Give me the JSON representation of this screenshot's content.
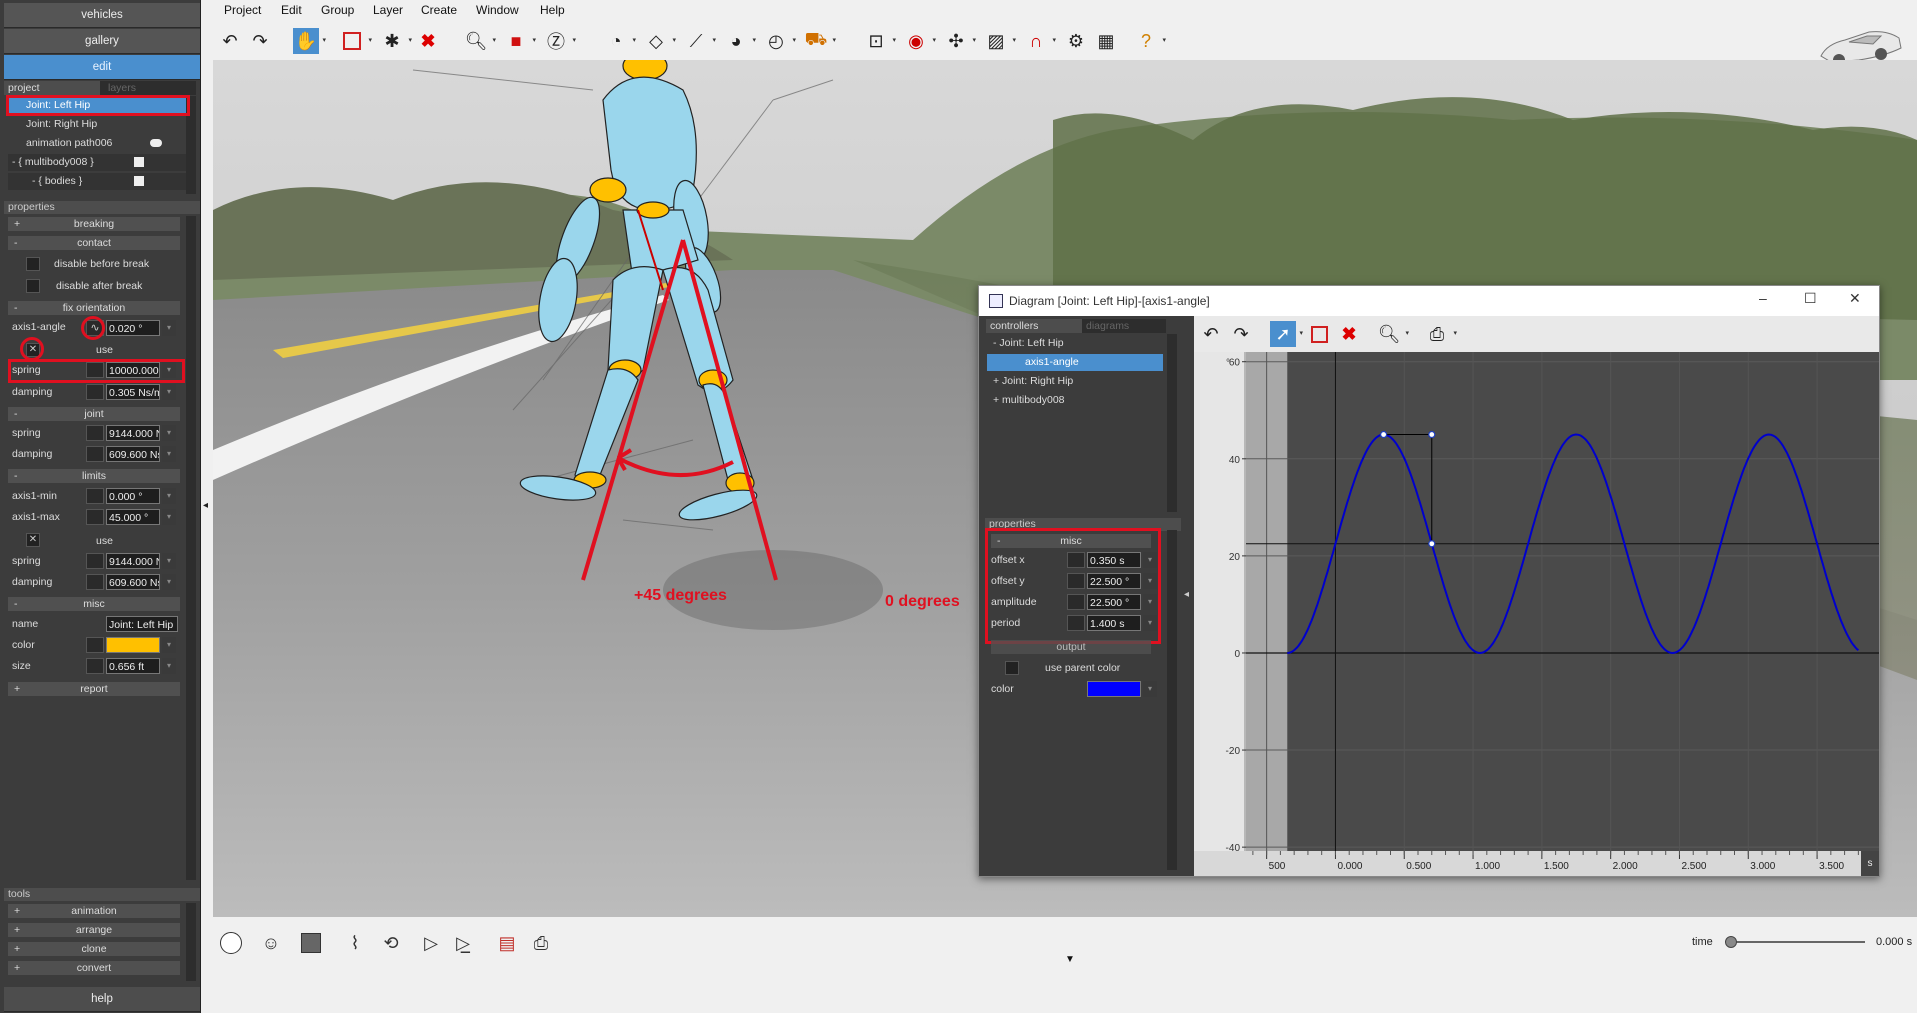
{
  "left_panel": {
    "nav": [
      "vehicles",
      "gallery",
      "edit"
    ],
    "project_tabs": {
      "project": "project",
      "layers": "layers"
    },
    "tree": [
      {
        "label": "Joint: Left Hip",
        "selected": true
      },
      {
        "label": "Joint: Right Hip",
        "selected": false
      },
      {
        "label": "animation path006",
        "selected": false
      },
      {
        "label": "- { multibody008 }",
        "selected": false
      },
      {
        "label": "- { bodies }",
        "selected": false
      }
    ],
    "properties_header": "properties",
    "sections": {
      "breaking": "breaking",
      "contact": "contact",
      "disable_before_break": "disable before break",
      "disable_after_break": "disable after break",
      "fix_orientation": "fix orientation",
      "axis1_angle_label": "axis1-angle",
      "axis1_angle_value": "0.020 °",
      "use_label": "use",
      "spring_label": "spring",
      "spring_value": "10000.000",
      "damping_label": "damping",
      "damping_value": "0.305 Ns/m",
      "joint": "joint",
      "joint_spring_label": "spring",
      "joint_spring_value": "9144.000 N",
      "joint_damping_label": "damping",
      "joint_damping_value": "609.600 Ns",
      "limits": "limits",
      "axis1_min_label": "axis1-min",
      "axis1_min_value": "0.000 °",
      "axis1_max_label": "axis1-max",
      "axis1_max_value": "45.000 °",
      "limits_use_label": "use",
      "limits_spring_label": "spring",
      "limits_spring_value": "9144.000 N",
      "limits_damping_label": "damping",
      "limits_damping_value": "609.600 Ns",
      "misc": "misc",
      "name_label": "name",
      "name_value": "Joint: Left Hip",
      "color_label": "color",
      "color_value": "#ffc000",
      "size_label": "size",
      "size_value": "0.656 ft",
      "report": "report"
    },
    "tools_header": "tools",
    "tools": [
      "animation",
      "arrange",
      "clone",
      "convert"
    ],
    "help": "help"
  },
  "menubar": [
    "Project",
    "Edit",
    "Group",
    "Layer",
    "Create",
    "Window",
    "Help"
  ],
  "viewport": {
    "label_left": "+45 degrees",
    "label_right": "0 degrees"
  },
  "diagram_window": {
    "title": "Diagram [Joint: Left Hip]-[axis1-angle]",
    "tabs": {
      "controllers": "controllers",
      "diagrams": "diagrams"
    },
    "tree": [
      {
        "label": "- Joint: Left Hip",
        "selected": false
      },
      {
        "label": "axis1-angle",
        "selected": true
      },
      {
        "label": "+ Joint: Right Hip",
        "selected": false
      },
      {
        "label": "+ multibody008",
        "selected": false
      }
    ],
    "properties_header": "properties",
    "misc_header": "misc",
    "offset_x_label": "offset x",
    "offset_x_value": "0.350 s",
    "offset_y_label": "offset y",
    "offset_y_value": "22.500 °",
    "amplitude_label": "amplitude",
    "amplitude_value": "22.500 °",
    "period_label": "period",
    "period_value": "1.400 s",
    "output_header": "output",
    "use_parent_color": "use parent color",
    "color_label": "color",
    "color_value": "#0000ff"
  },
  "chart_data": {
    "type": "line",
    "ylabel": "°",
    "xunit": "s",
    "y_ticks": [
      60,
      40,
      20,
      0,
      -20,
      -40
    ],
    "x_ticks": [
      "500",
      "0.000",
      "0.500",
      "1.000",
      "1.500",
      "2.000",
      "2.500",
      "3.000",
      "3.500"
    ],
    "x_tick_values": [
      -0.5,
      0.0,
      0.5,
      1.0,
      1.5,
      2.0,
      2.5,
      3.0,
      3.5
    ],
    "xlim": [
      -0.65,
      3.95
    ],
    "ylim": [
      -41,
      62
    ],
    "series": [
      {
        "color": "#0000cc",
        "function": "sine",
        "offset_x": 0.35,
        "offset_y": 22.5,
        "amplitude": 22.5,
        "period": 1.4,
        "x_start": -0.35,
        "x_end": 3.8
      }
    ],
    "handle_points": [
      {
        "x": 0.35,
        "y": 45
      },
      {
        "x": 0.7,
        "y": 45
      },
      {
        "x": 0.7,
        "y": 22.5
      }
    ],
    "crosshair": {
      "x": 0.0,
      "y": 22.5
    }
  },
  "bottom": {
    "time_label": "time",
    "time_value": "0.000 s"
  }
}
